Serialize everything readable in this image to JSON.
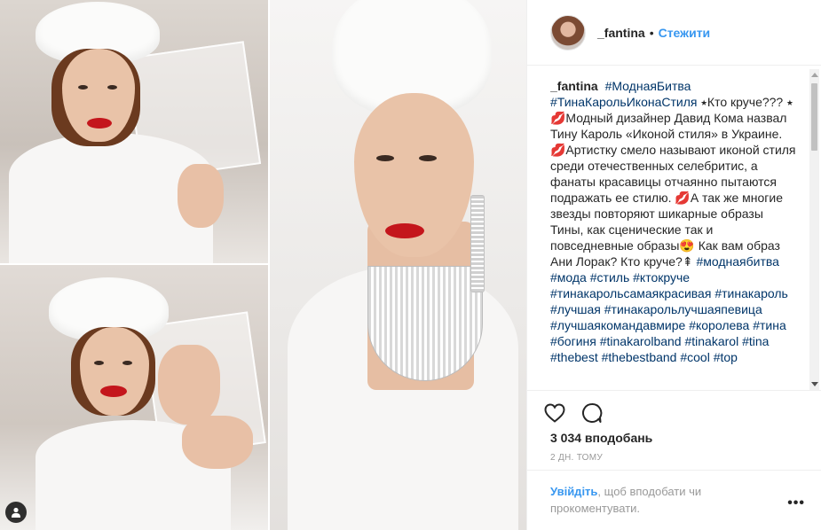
{
  "post": {
    "username": "_fantina",
    "separator": "•",
    "follow_label": "Стежити",
    "caption_segments": [
      {
        "text": "#МоднаяБитва",
        "tag": true
      },
      {
        "text": " ",
        "tag": false
      },
      {
        "text": "#ТинаКарольИконаСтиля",
        "tag": true
      },
      {
        "text": " ⭑Кто круче??? ⭑ 💋Модный дизайнер Давид Кома назвал Тину Кароль «Иконой стиля» в Украине. 💋Артистку смело называют иконой стиля среди отечественных селебритис, а фанаты красавицы отчаянно пытаются подражать ее стилю. 💋А так же многие звезды повторяют шикарные образы Тины, как сценические так и повседневные образы😍 Как вам образ Ани Лорак? Кто круче?⇞ ",
        "tag": false
      },
      {
        "text": "#моднаябитва",
        "tag": true
      },
      {
        "text": " ",
        "tag": false
      },
      {
        "text": "#мода",
        "tag": true
      },
      {
        "text": " ",
        "tag": false
      },
      {
        "text": "#стиль",
        "tag": true
      },
      {
        "text": " ",
        "tag": false
      },
      {
        "text": "#ктокруче",
        "tag": true
      },
      {
        "text": " ",
        "tag": false
      },
      {
        "text": "#тинакарольсамаякрасивая",
        "tag": true
      },
      {
        "text": " ",
        "tag": false
      },
      {
        "text": "#тинакароль",
        "tag": true
      },
      {
        "text": " ",
        "tag": false
      },
      {
        "text": "#лучшая",
        "tag": true
      },
      {
        "text": " ",
        "tag": false
      },
      {
        "text": "#тинакарольлучшаяпевица",
        "tag": true
      },
      {
        "text": " ",
        "tag": false
      },
      {
        "text": "#лучшаякомандавмире",
        "tag": true
      },
      {
        "text": " ",
        "tag": false
      },
      {
        "text": "#королева",
        "tag": true
      },
      {
        "text": " ",
        "tag": false
      },
      {
        "text": "#тина",
        "tag": true
      },
      {
        "text": " ",
        "tag": false
      },
      {
        "text": "#богиня",
        "tag": true
      },
      {
        "text": " ",
        "tag": false
      },
      {
        "text": "#tinakarolband",
        "tag": true
      },
      {
        "text": " ",
        "tag": false
      },
      {
        "text": "#tinakarol",
        "tag": true
      },
      {
        "text": " ",
        "tag": false
      },
      {
        "text": "#tina",
        "tag": true
      },
      {
        "text": " ",
        "tag": false
      },
      {
        "text": "#thebest",
        "tag": true
      },
      {
        "text": " ",
        "tag": false
      },
      {
        "text": "#thebestband",
        "tag": true
      },
      {
        "text": " ",
        "tag": false
      },
      {
        "text": "#cool",
        "tag": true
      },
      {
        "text": " ",
        "tag": false
      },
      {
        "text": "#top",
        "tag": true
      }
    ],
    "likes_text": "3 034 вподобань",
    "time_text": "2 ДН. ТОМУ",
    "login_link": "Увійдіть",
    "login_rest": ", щоб вподобати чи прокоментувати.",
    "more_label": "•••"
  },
  "icons": {
    "like": "heart-icon",
    "comment": "comment-icon",
    "user_tag": "user-tag-icon",
    "more": "more-options-icon"
  },
  "colors": {
    "link_blue": "#3897f0",
    "hashtag": "#003569",
    "lipstick": "#c4161c",
    "muted": "#999999"
  }
}
